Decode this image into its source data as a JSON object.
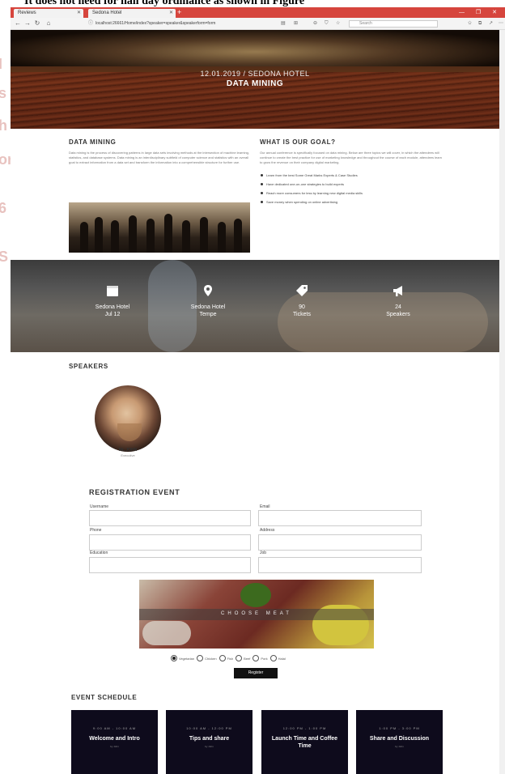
{
  "caption": "It does not need for hall day ordinance as shown in Figure",
  "browser": {
    "tabs": [
      {
        "label": "Reviews"
      },
      {
        "label": "Sedona Hotel"
      }
    ],
    "url": "localhost:26661/Home/index?speaker=speaker&speakerform=form",
    "search_placeholder": "Search",
    "controls": "— ❐ ✕"
  },
  "left_ghost": [
    "I",
    "s",
    "h",
    "or",
    "6",
    "S"
  ],
  "hero": {
    "date_line": "12.01.2019 / SEDONA HOTEL",
    "title": "DATA MINING"
  },
  "about": {
    "left_title": "DATA MINING",
    "left_text": "Data mining is the process of discovering patterns in large data sets involving methods at the intersection of machine learning, statistics, and database systems. Data mining is an interdisciplinary subfield of computer science and statistics with an overall goal to extract information from a data set and transform the information into a comprehensible structure for further use.",
    "right_title": "WHAT IS OUR GOAL?",
    "right_text": "Our annual conference is specifically focused on data mining. Below are three topics we will cover, in which the attendees will continue to create the best practice for use of marketing knowledge and throughout the course of each module, attendees learn to grow the revenue on their company digital marketing.",
    "goals": [
      "Learn from the best Some Great Marks Experts & Case Studies",
      "Have dedicated one-on-one strategies to build experts",
      "Reach more consumers for less by learning new digital media skills",
      "Save money when spending on online advertising"
    ]
  },
  "stats": [
    {
      "icon": "calendar-icon",
      "line1": "Sedona Hotel",
      "line2": "Jul 12"
    },
    {
      "icon": "location-pin-icon",
      "line1": "Sedona Hotel",
      "line2": "Tempe"
    },
    {
      "icon": "tag-icon",
      "line1": "90",
      "line2": "Tickets"
    },
    {
      "icon": "megaphone-icon",
      "line1": "24",
      "line2": "Speakers"
    }
  ],
  "speakers": {
    "title": "SPEAKERS",
    "items": [
      {
        "name": "Mr. JOHN",
        "role": "Executive"
      }
    ]
  },
  "registration": {
    "title": "REGISTRATION EVENT",
    "fields": [
      {
        "label": "Username"
      },
      {
        "label": "Email"
      },
      {
        "label": "Phone"
      },
      {
        "label": "Address"
      },
      {
        "label": "Education"
      },
      {
        "label": "Job"
      }
    ],
    "banner_text": "CHOOSE MEAT",
    "options": [
      {
        "label": "Vegetarian",
        "checked": true
      },
      {
        "label": "Chicken",
        "checked": false
      },
      {
        "label": "Fish",
        "checked": false
      },
      {
        "label": "Beef",
        "checked": false
      },
      {
        "label": "Pork",
        "checked": false
      },
      {
        "label": "Halal",
        "checked": false
      }
    ],
    "submit_label": "Register"
  },
  "schedule": {
    "title": "EVENT SCHEDULE",
    "cards": [
      {
        "time": "9:00 AM - 10:00 AM",
        "title": "Welcome and Intro",
        "by": "by John"
      },
      {
        "time": "10:00 AM - 12:00 PM",
        "title": "Tips and share",
        "by": "by John"
      },
      {
        "time": "12:00 PM - 1:00 PM",
        "title": "Launch Time and Coffee Time",
        "by": ""
      },
      {
        "time": "1:00 PM - 3:00 PM",
        "title": "Share and Discussion",
        "by": "by John"
      }
    ]
  },
  "colors": {
    "tab_bar": "#d6453d",
    "card_bg": "#0e0b1c",
    "button_bg": "#111111"
  }
}
